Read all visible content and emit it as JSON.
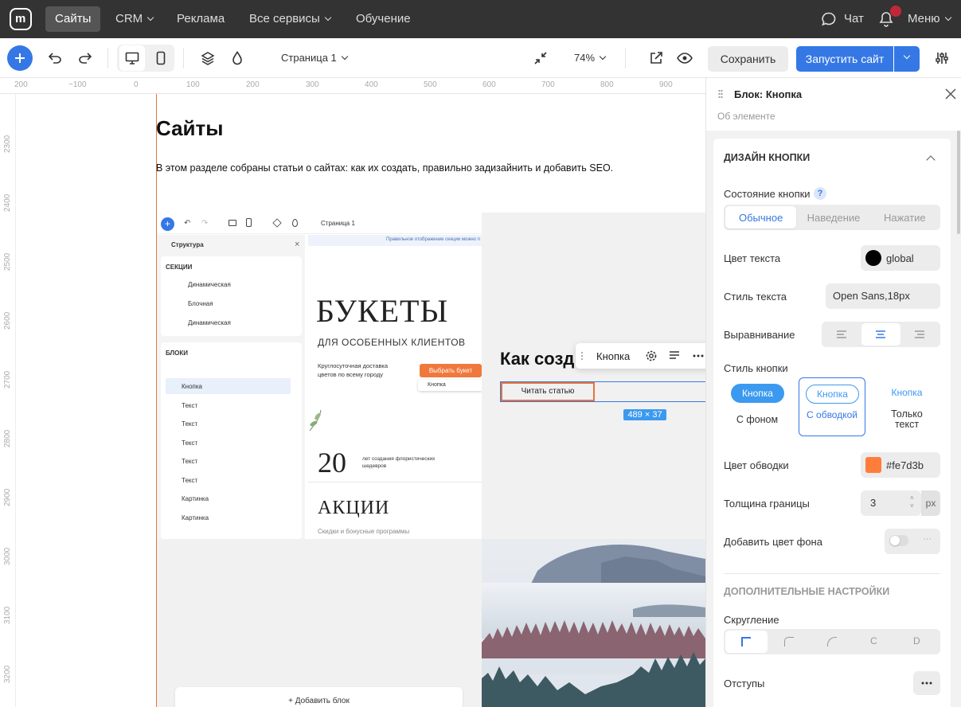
{
  "nav": {
    "items": [
      "Сайты",
      "CRM",
      "Реклама",
      "Все сервисы",
      "Обучение"
    ],
    "chat": "Чат",
    "menu": "Меню"
  },
  "toolbar": {
    "page_select": "Страница 1",
    "zoom": "74%",
    "save": "Сохранить",
    "publish": "Запустить сайт"
  },
  "ruler": {
    "h": [
      "200",
      "−100",
      "0",
      "100",
      "200",
      "300",
      "400",
      "500",
      "600",
      "700",
      "800",
      "900"
    ],
    "v": [
      "2300",
      "2400",
      "2500",
      "2600",
      "2700",
      "2800",
      "2900",
      "3000",
      "3100",
      "3200"
    ]
  },
  "page": {
    "title": "Сайты",
    "intro": "В этом разделе собраны статьи о сайтах: как их создать, правильно задизайнить и добавить SEO.",
    "card_heading": "Как созд",
    "card_button": "Читать статью",
    "add_block": "+ Добавить блок",
    "size_badge": "489 × 37"
  },
  "float_toolbar": {
    "label": "Кнопка"
  },
  "mini": {
    "page": "Страница 1",
    "structure": "Структура",
    "sections_title": "СЕКЦИИ",
    "sections": [
      "Динамическая",
      "Блочная",
      "Динамическая"
    ],
    "blocks_title": "БЛОКИ",
    "blocks": [
      "Кнопка",
      "Текст",
      "Текст",
      "Текст",
      "Текст",
      "Текст",
      "Картинка",
      "Картинка"
    ],
    "banner": "Правильное отображение секции можно п",
    "hero_title": "БУКЕТЫ",
    "hero_sub": "ДЛЯ ОСОБЕННЫХ КЛИЕНТОВ",
    "hero_desc": "Круглосуточная доставка цветов по всему городу",
    "hero_btn": "Выбрать букет",
    "hero_btn_tb": "Кнопка",
    "stat_num": "20",
    "stat_text": "лет создания флористических шедевров",
    "promo_title": "АКЦИИ",
    "promo_sub": "Скидки и бонусные программы"
  },
  "panel": {
    "title": "Блок: Кнопка",
    "about": "Об элементе",
    "design_title": "ДИЗАЙН КНОПКИ",
    "state_label": "Состояние кнопки",
    "help": "?",
    "states": [
      "Обычное",
      "Наведение",
      "Нажатие"
    ],
    "text_color_label": "Цвет текста",
    "text_color_value": "global",
    "text_style_label": "Стиль текста",
    "text_style_value": "Open Sans,18px",
    "align_label": "Выравнивание",
    "button_style_label": "Стиль кнопки",
    "styles": [
      {
        "preview": "Кнопка",
        "caption": "С фоном"
      },
      {
        "preview": "Кнопка",
        "caption": "С обводкой"
      },
      {
        "preview": "Кнопка",
        "caption": "Только текст"
      }
    ],
    "border_color_label": "Цвет обводки",
    "border_color_value": "#fe7d3b",
    "border_width_label": "Толщина границы",
    "border_width_value": "3",
    "border_unit": "px",
    "bg_color_label": "Добавить цвет фона",
    "extra_title": "ДОПОЛНИТЕЛЬНЫЕ НАСТРОЙКИ",
    "radius_label": "Скругление",
    "radius_options": [
      "C",
      "D"
    ],
    "padding_label": "Отступы"
  },
  "colors": {
    "accent": "#3578e5",
    "border_orange": "#fe7d3b",
    "nav_bg": "#333333"
  }
}
